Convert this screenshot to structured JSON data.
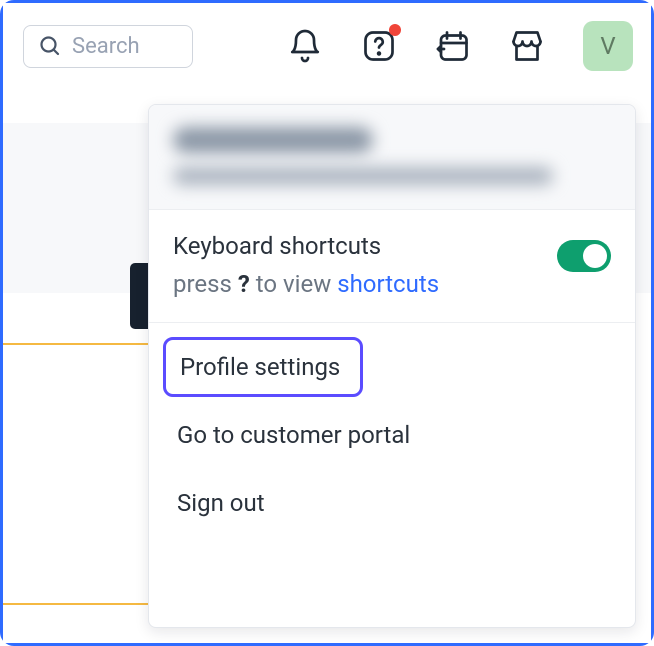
{
  "search": {
    "placeholder": "Search"
  },
  "avatar": {
    "initial": "V"
  },
  "dropdown": {
    "keyboard": {
      "title": "Keyboard shortcuts",
      "hint_prefix": "press ",
      "hint_key": "?",
      "hint_middle": " to view ",
      "hint_link": "shortcuts",
      "enabled": true
    },
    "items": {
      "profile": "Profile settings",
      "portal": "Go to customer portal",
      "signout": "Sign out"
    }
  }
}
